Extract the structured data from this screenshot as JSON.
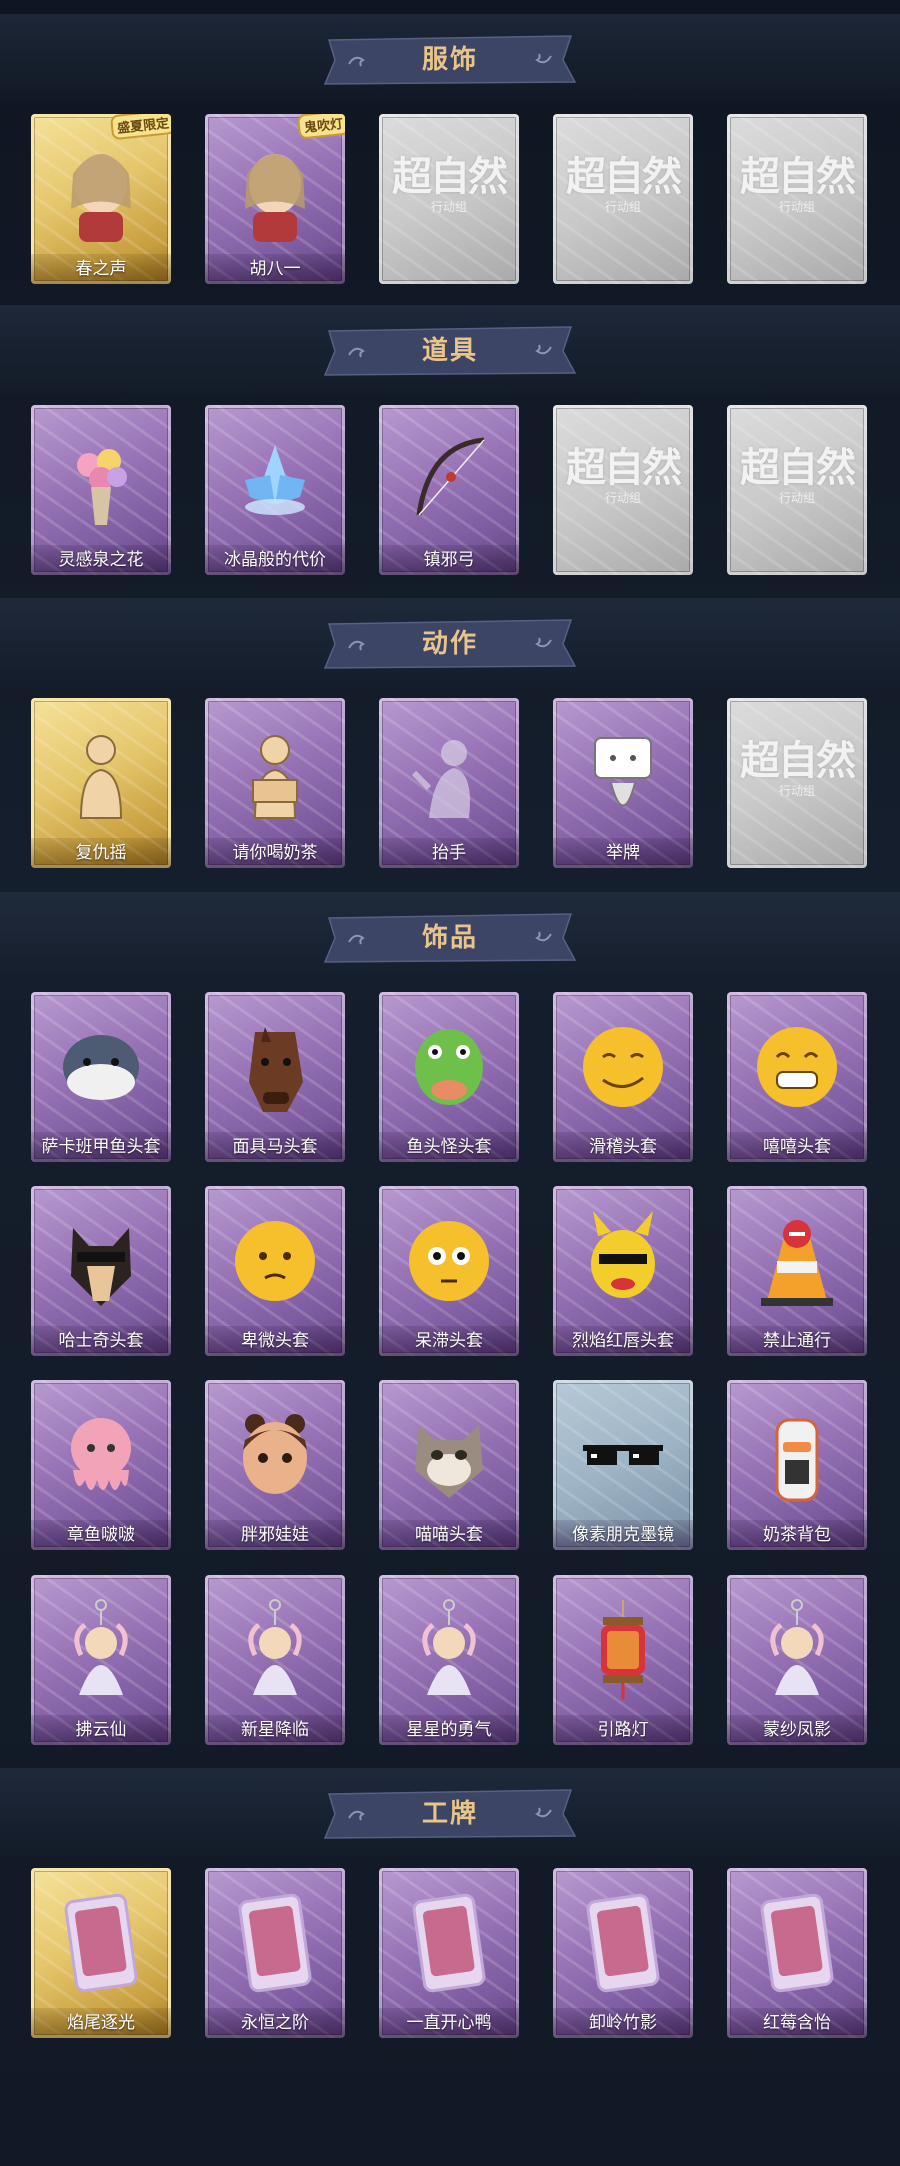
{
  "sections": [
    {
      "title": "服饰",
      "items": [
        {
          "label": "春之声",
          "style": "gold",
          "icon": "portrait-icon",
          "badge": "盛夏限定"
        },
        {
          "label": "胡八一",
          "style": "purple",
          "icon": "portrait-icon",
          "badge": "鬼吹灯"
        },
        {
          "label": "",
          "style": "gray",
          "icon": "locked-icon",
          "locked_text": "超自然",
          "locked_sub": "行动组"
        },
        {
          "label": "",
          "style": "gray",
          "icon": "locked-icon",
          "locked_text": "超自然",
          "locked_sub": "行动组"
        },
        {
          "label": "",
          "style": "gray",
          "icon": "locked-icon",
          "locked_text": "超自然",
          "locked_sub": "行动组"
        }
      ]
    },
    {
      "title": "道具",
      "items": [
        {
          "label": "灵感泉之花",
          "style": "purple",
          "icon": "bouquet-icon"
        },
        {
          "label": "冰晶般的代价",
          "style": "purple",
          "icon": "ice-lotus-icon"
        },
        {
          "label": "镇邪弓",
          "style": "purple",
          "icon": "bow-icon"
        },
        {
          "label": "",
          "style": "gray",
          "icon": "locked-icon",
          "locked_text": "超自然",
          "locked_sub": "行动组"
        },
        {
          "label": "",
          "style": "gray",
          "icon": "locked-icon",
          "locked_text": "超自然",
          "locked_sub": "行动组"
        }
      ]
    },
    {
      "title": "动作",
      "items": [
        {
          "label": "复仇摇",
          "style": "gold",
          "icon": "dance-pose-icon"
        },
        {
          "label": "请你喝奶茶",
          "style": "purple",
          "icon": "offer-tea-icon"
        },
        {
          "label": "抬手",
          "style": "purple",
          "icon": "raise-hand-icon"
        },
        {
          "label": "举牌",
          "style": "purple",
          "icon": "hold-sign-icon"
        },
        {
          "label": "",
          "style": "gray",
          "icon": "locked-icon",
          "locked_text": "超自然",
          "locked_sub": "行动组"
        }
      ]
    },
    {
      "title": "饰品",
      "items": [
        {
          "label": "萨卡班甲鱼头套",
          "style": "purple",
          "icon": "fish-head-icon"
        },
        {
          "label": "面具马头套",
          "style": "purple",
          "icon": "horse-head-icon"
        },
        {
          "label": "鱼头怪头套",
          "style": "purple",
          "icon": "frog-fish-head-icon"
        },
        {
          "label": "滑稽头套",
          "style": "purple",
          "icon": "funny-emoji-icon"
        },
        {
          "label": "嘻嘻头套",
          "style": "purple",
          "icon": "grin-emoji-icon"
        },
        {
          "label": "哈士奇头套",
          "style": "purple",
          "icon": "dog-head-icon"
        },
        {
          "label": "卑微头套",
          "style": "purple",
          "icon": "humble-emoji-icon"
        },
        {
          "label": "呆滞头套",
          "style": "purple",
          "icon": "dazed-emoji-icon"
        },
        {
          "label": "烈焰红唇头套",
          "style": "purple",
          "icon": "red-lips-head-icon"
        },
        {
          "label": "禁止通行",
          "style": "purple",
          "icon": "traffic-cone-icon"
        },
        {
          "label": "章鱼啵啵",
          "style": "purple",
          "icon": "octopus-icon"
        },
        {
          "label": "胖邪娃娃",
          "style": "purple",
          "icon": "doll-head-icon"
        },
        {
          "label": "喵喵头套",
          "style": "purple",
          "icon": "cat-head-icon"
        },
        {
          "label": "像素朋克墨镜",
          "style": "steel",
          "icon": "pixel-sunglasses-icon"
        },
        {
          "label": "奶茶背包",
          "style": "purple",
          "icon": "tea-backpack-icon"
        },
        {
          "label": "拂云仙",
          "style": "purple",
          "icon": "charm-pendant-icon"
        },
        {
          "label": "新星降临",
          "style": "purple",
          "icon": "charm-pendant-icon"
        },
        {
          "label": "星星的勇气",
          "style": "purple",
          "icon": "charm-pendant-icon"
        },
        {
          "label": "引路灯",
          "style": "purple",
          "icon": "lantern-icon"
        },
        {
          "label": "蒙纱凤影",
          "style": "purple",
          "icon": "charm-pendant-icon"
        }
      ]
    },
    {
      "title": "工牌",
      "items": [
        {
          "label": "焰尾逐光",
          "style": "gold",
          "icon": "badge-card-icon"
        },
        {
          "label": "永恒之阶",
          "style": "purple",
          "icon": "badge-card-icon"
        },
        {
          "label": "一直开心鸭",
          "style": "purple",
          "icon": "badge-card-icon"
        },
        {
          "label": "卸岭竹影",
          "style": "purple",
          "icon": "badge-card-icon"
        },
        {
          "label": "红莓含怡",
          "style": "purple",
          "icon": "badge-card-icon"
        }
      ]
    }
  ],
  "colors": {
    "background": "#121a27",
    "title_gold": "#e9c58a",
    "banner": "#3c4566"
  }
}
